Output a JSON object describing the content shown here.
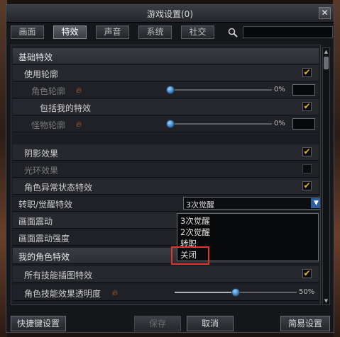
{
  "window": {
    "title": "游戏设置(0)",
    "close": "✕"
  },
  "tabs": [
    "画面",
    "特效",
    "声音",
    "系统",
    "社交"
  ],
  "active_tab": "特效",
  "search": {
    "value": "",
    "placeholder": ""
  },
  "sections": [
    {
      "header": "基础特效",
      "rows": [
        {
          "label": "使用轮廓",
          "checked": true
        },
        {
          "label": "角色轮廓",
          "slider": 0,
          "percent": "0%"
        },
        {
          "label": "包括我的特效",
          "checked": true
        },
        {
          "label": "怪物轮廓",
          "slider": 0,
          "percent": "0%"
        },
        {
          "label": "阴影效果",
          "checked": true
        },
        {
          "label": "光环效果",
          "checked": false
        },
        {
          "label": "角色异常状态特效",
          "checked": true
        },
        {
          "label": "转职/觉醒特效",
          "select": "3次觉醒"
        },
        {
          "label": "画面震动"
        },
        {
          "label": "画面震动强度"
        }
      ]
    },
    {
      "header": "我的角色特效",
      "rows": [
        {
          "label": "所有技能插图特效",
          "checked": true
        },
        {
          "label": "角色技能效果透明度",
          "slider": 0.5,
          "percent": "50%"
        }
      ]
    }
  ],
  "dropdown_options": [
    "3次觉醒",
    "2次觉醒",
    "转职",
    "关闭"
  ],
  "buttons": {
    "shortcut": "快捷键设置",
    "save": "保存",
    "cancel": "取消",
    "simple": "简易设置"
  },
  "icons": {
    "search": "magnifier",
    "fire": "flame",
    "check": "✔"
  },
  "colors": {
    "accent_check": "#f2b22a",
    "highlight": "#e0332d",
    "select_arrow": "#2f5f9e"
  }
}
